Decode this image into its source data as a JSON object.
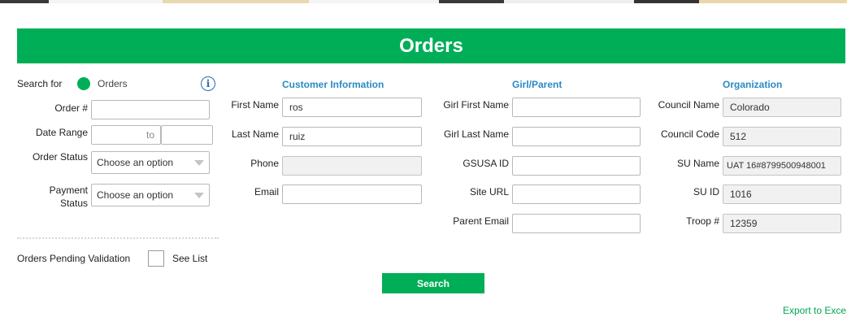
{
  "page": {
    "title": "Orders"
  },
  "search_for": {
    "label": "Search for",
    "option": "Orders"
  },
  "filters": {
    "order_label": "Order #",
    "order_value": "",
    "date_range_label": "Date Range",
    "date_from": "",
    "date_to_sep": "to",
    "date_to": "",
    "order_status_label": "Order Status",
    "order_status_value": "Choose an option",
    "payment_status_label_1": "Payment",
    "payment_status_label_2": "Status",
    "payment_status_value": "Choose an option"
  },
  "customer": {
    "heading": "Customer Information",
    "first_name_label": "First Name",
    "first_name": "ros",
    "last_name_label": "Last Name",
    "last_name": "ruiz",
    "phone_label": "Phone",
    "phone": "",
    "email_label": "Email",
    "email": ""
  },
  "girl_parent": {
    "heading": "Girl/Parent",
    "girl_first_label": "Girl First Name",
    "girl_first": "",
    "girl_last_label": "Girl Last Name",
    "girl_last": "",
    "gsusa_label": "GSUSA ID",
    "gsusa": "",
    "site_url_label": "Site URL",
    "site_url": "",
    "parent_email_label": "Parent Email",
    "parent_email": ""
  },
  "organization": {
    "heading": "Organization",
    "council_name_label": "Council Name",
    "council_name": "Colorado",
    "council_code_label": "Council Code",
    "council_code": "512",
    "su_name_label": "SU Name",
    "su_name": "UAT 16#8799500948001",
    "su_id_label": "SU ID",
    "su_id": "1016",
    "troop_label": "Troop #",
    "troop": "12359"
  },
  "pending": {
    "label": "Orders Pending Validation",
    "see_list": "See List"
  },
  "actions": {
    "search": "Search",
    "export": "Export to Exce"
  },
  "colors": {
    "brand_green": "#00ae58",
    "heading_blue": "#2a8ac4"
  }
}
